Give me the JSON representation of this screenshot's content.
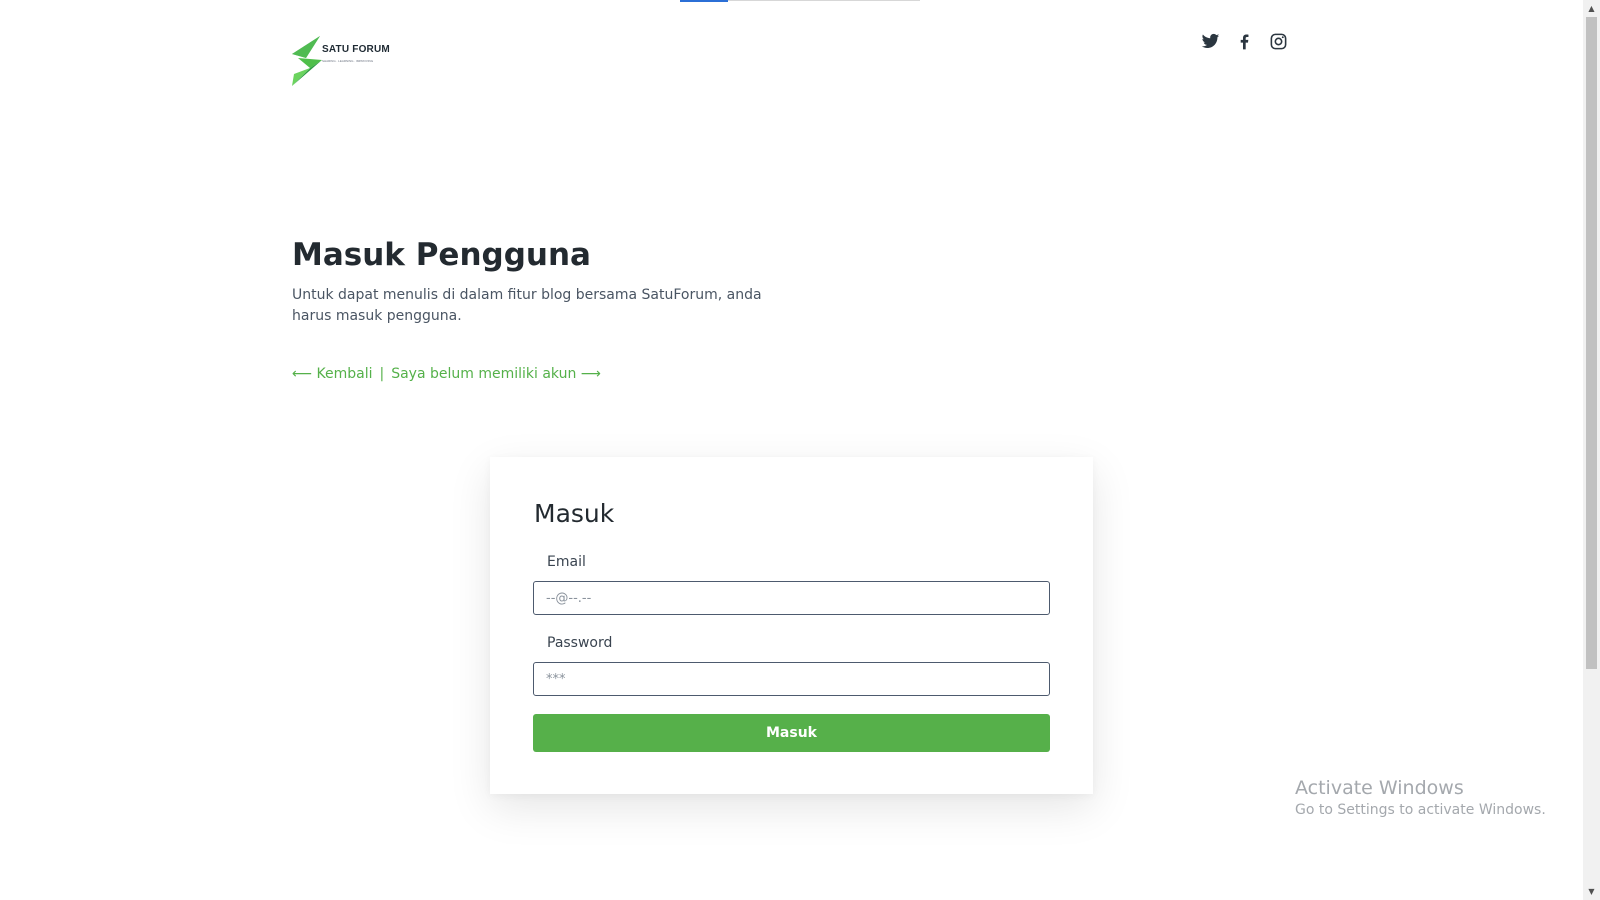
{
  "top_progress": {
    "value": 0.2
  },
  "header": {
    "logo": {
      "name": "SATU FORUM",
      "tagline": "SHARING . LEARNING . IMPROVING",
      "colors": {
        "green_dark": "#2f9e44",
        "green_light": "#6bd35e",
        "text": "#1f2a33"
      }
    },
    "social": [
      {
        "icon": "twitter-icon",
        "label": "Twitter"
      },
      {
        "icon": "facebook-icon",
        "label": "Facebook"
      },
      {
        "icon": "instagram-icon",
        "label": "Instagram"
      }
    ]
  },
  "hero": {
    "title": "Masuk Pengguna",
    "description": "Untuk dapat menulis di dalam fitur blog bersama SatuForum, anda harus masuk pengguna.",
    "back_link": "⟵ Kembali",
    "separator": "|",
    "register_link": "Saya belum memiliki akun ⟶"
  },
  "login_form": {
    "title": "Masuk",
    "email_label": "Email",
    "email_placeholder": "--@--.--",
    "email_value": "",
    "password_label": "Password",
    "password_placeholder": "***",
    "password_value": "",
    "submit_label": "Masuk"
  },
  "watermark": {
    "title": "Activate Windows",
    "subtitle": "Go to Settings to activate Windows."
  },
  "colors": {
    "accent_green": "#56b04a",
    "link_green": "#55b14a",
    "progress_blue": "#2b6fd6",
    "input_border": "#4d5a6e"
  }
}
